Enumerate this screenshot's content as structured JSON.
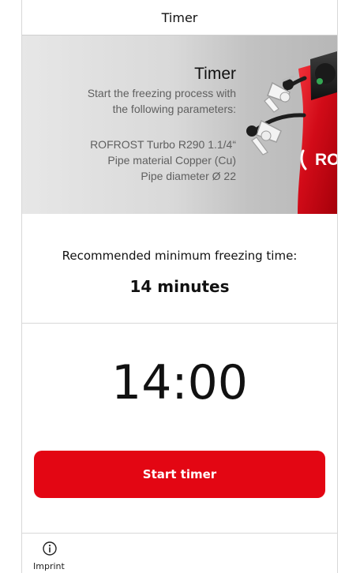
{
  "header": {
    "title": "Timer"
  },
  "banner": {
    "title": "Timer",
    "line1": "Start the freezing process with",
    "line2": "the following parameters:",
    "detail1": "ROFROST Turbo R290 1.1/4“",
    "detail2": "Pipe material Copper (Cu)",
    "detail3": "Pipe diameter Ø 22",
    "logo_text": "RO"
  },
  "recommendation": {
    "label": "Recommended minimum freezing time:",
    "value": "14 minutes"
  },
  "timer": {
    "display": "14:00"
  },
  "actions": {
    "start_label": "Start timer"
  },
  "footer": {
    "imprint_label": "Imprint",
    "imprint_icon": "info-circle-icon"
  },
  "colors": {
    "accent": "#e30613",
    "divider": "#d8d8d8",
    "banner_bg": "#d9d9d9"
  }
}
